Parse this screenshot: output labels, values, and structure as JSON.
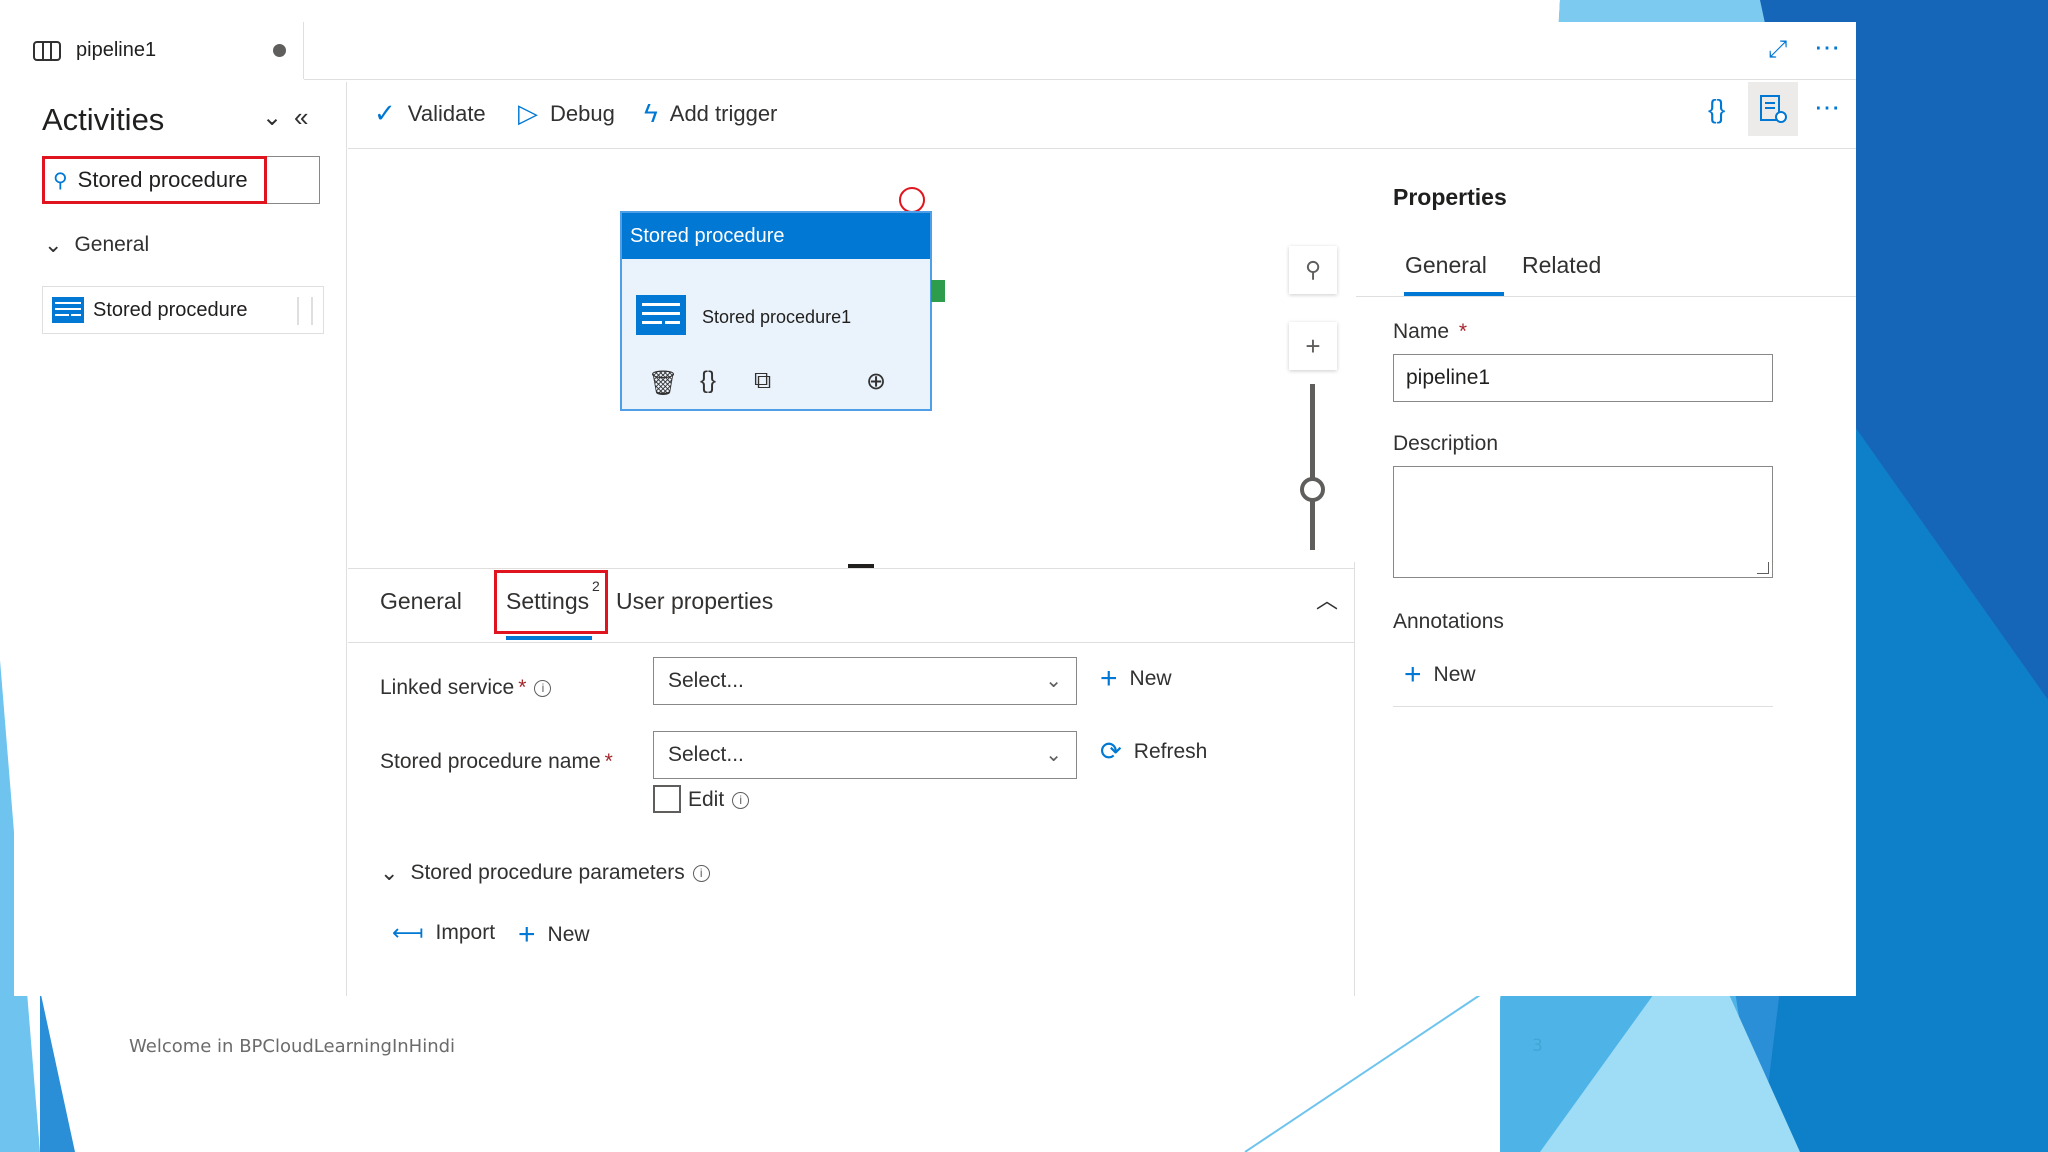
{
  "colors": {
    "accent": "#0078d4",
    "highlight": "#e0141e",
    "handle": "#2e9d4b",
    "slide_blue": "#1e88d4"
  },
  "tab": {
    "title": "pipeline1",
    "icon": "pipeline-icon"
  },
  "window_actions": {
    "expand_icon": "expand-icon",
    "more_icon": "more-icon"
  },
  "toolbar": {
    "validate": "Validate",
    "debug": "Debug",
    "add_trigger": "Add trigger",
    "code_icon": "code-icon",
    "properties_icon": "properties-icon",
    "more_icon": "more-icon"
  },
  "activities": {
    "title": "Activities",
    "search_value": "Stored procedure",
    "group_label": "General",
    "item_label": "Stored procedure"
  },
  "canvas": {
    "node_type": "Stored procedure",
    "node_name": "Stored procedure1",
    "node_actions": [
      "delete-icon",
      "code-icon",
      "copy-icon",
      "add-output-icon"
    ]
  },
  "bottom_panel": {
    "tabs": [
      "General",
      "Settings",
      "User properties"
    ],
    "active_tab": "Settings",
    "settings_badge": "2",
    "linked_service": {
      "label": "Linked service",
      "required": "*",
      "value": "Select...",
      "action": "New"
    },
    "stored_procedure": {
      "label": "Stored procedure name",
      "required": "*",
      "value": "Select...",
      "action": "Refresh",
      "edit_label": "Edit",
      "edit_checked": false
    },
    "params": {
      "label": "Stored procedure parameters",
      "import": "Import",
      "new": "New"
    }
  },
  "properties": {
    "title": "Properties",
    "tabs": [
      "General",
      "Related"
    ],
    "active_tab": "General",
    "name_label": "Name",
    "name_required": "*",
    "name_value": "pipeline1",
    "description_label": "Description",
    "description_value": "",
    "annotations_label": "Annotations",
    "annotations_action": "New"
  },
  "slide": {
    "footer": "Welcome in BPCloudLearningInHindi",
    "page_number": "3"
  }
}
